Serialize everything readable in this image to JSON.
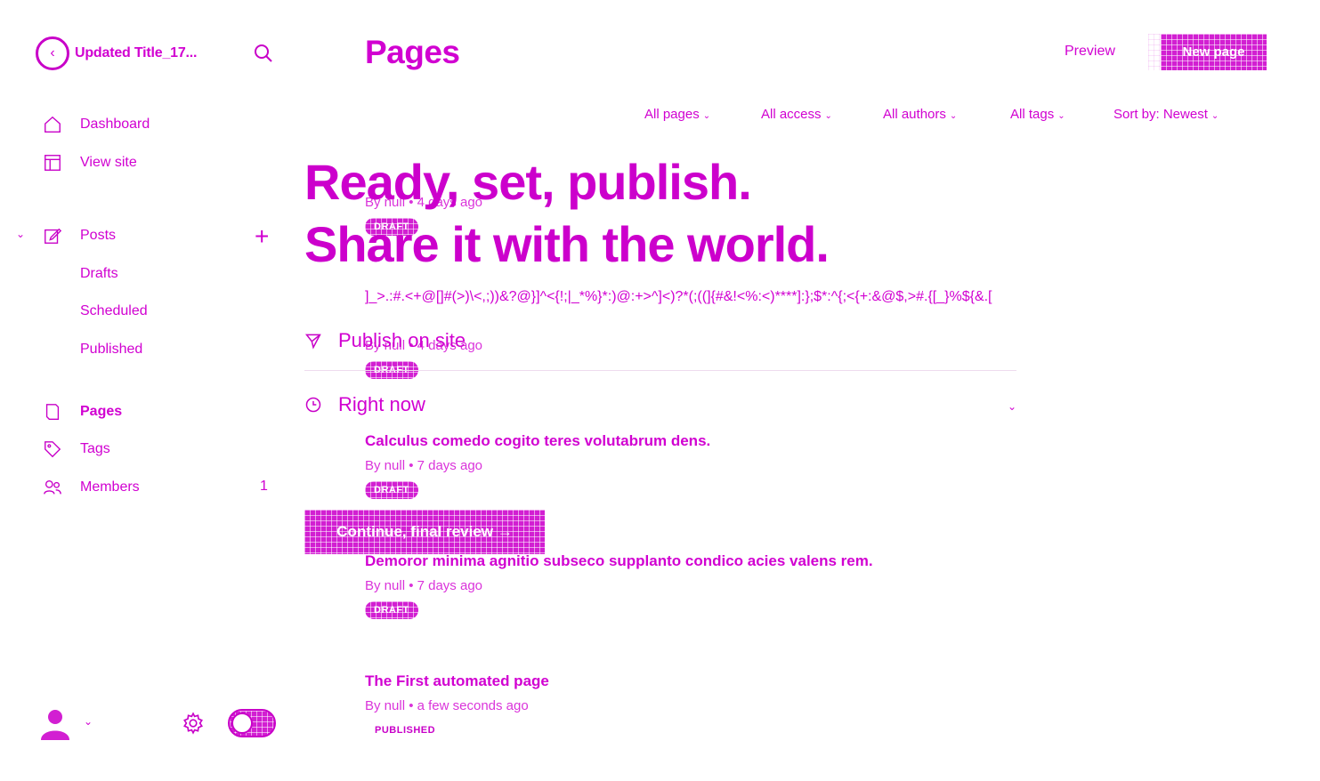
{
  "colors": {
    "accent": "#d100d1",
    "button_fill": "#d21fd2",
    "background": "#ffffff"
  },
  "sidebar": {
    "site_title": "Updated Title_17...",
    "nav": {
      "dashboard": "Dashboard",
      "view_site": "View site",
      "posts": "Posts",
      "drafts": "Drafts",
      "scheduled": "Scheduled",
      "published": "Published",
      "pages": "Pages",
      "tags": "Tags",
      "members": "Members",
      "members_count": "1"
    }
  },
  "header": {
    "title": "Pages",
    "preview": "Preview",
    "new_page": "New page"
  },
  "filters": {
    "pages": "All pages",
    "access": "All access",
    "authors": "All authors",
    "tags": "All tags",
    "sort": "Sort by: Newest"
  },
  "pages_list": [
    {
      "title": "",
      "meta": "By null • 4 days ago",
      "status": "DRAFT"
    },
    {
      "title": "]_>.:#.<+@[]#(>)\\<,;))&?@}]^<{!;|_*%}*:)@:+>^]<)?*(;((]{#&!<%:<)****]:};$*:^{;<{+:&@$,>#.{[_}%${&.[",
      "meta": "By null • 4 days ago",
      "status": "DRAFT"
    },
    {
      "title": "Calculus comedo cogito teres volutabrum dens.",
      "meta": "By null • 7 days ago",
      "status": "DRAFT"
    },
    {
      "title": "Demoror minima agnitio subseco supplanto condico acies valens rem.",
      "meta": "By null • 7 days ago",
      "status": "DRAFT"
    },
    {
      "title": "The First automated page",
      "meta": "By null • a few seconds ago",
      "status": "PUBLISHED"
    }
  ],
  "publish_modal": {
    "heading_line1": "Ready, set, publish.",
    "heading_line2": "Share it with the world.",
    "publish_option": "Publish on site",
    "time_option": "Right now",
    "continue_button": "Continue, final review →"
  }
}
